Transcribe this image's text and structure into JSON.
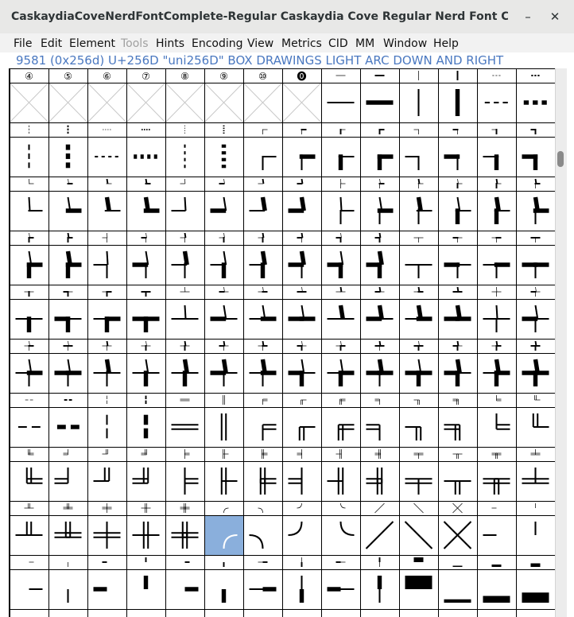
{
  "window": {
    "title": "CaskaydiaCoveNerdFontComplete-Regular  Caskaydia Cove Regular Nerd Font Complete.otf (...",
    "minimize_glyph": "–",
    "close_glyph": "✕"
  },
  "menu": [
    {
      "label": "File",
      "enabled": true
    },
    {
      "label": "Edit",
      "enabled": true
    },
    {
      "label": "Element",
      "enabled": true
    },
    {
      "label": "Tools",
      "enabled": false
    },
    {
      "label": "Hints",
      "enabled": true
    },
    {
      "label": "Encoding",
      "enabled": true
    },
    {
      "label": "View",
      "enabled": true
    },
    {
      "label": "Metrics",
      "enabled": true
    },
    {
      "label": "CID",
      "enabled": true
    },
    {
      "label": "MM",
      "enabled": true
    },
    {
      "label": "Window",
      "enabled": true
    },
    {
      "label": "Help",
      "enabled": true
    }
  ],
  "info": {
    "text": "9581 (0x256d) U+256D \"uni256D\" BOX DRAWINGS LIGHT ARC DOWN AND RIGHT"
  },
  "grid": {
    "selected_codepoint": "U+256D",
    "first_row_headers": [
      "④",
      "⑤",
      "⑥",
      "⑦",
      "⑧",
      "⑨",
      "⑩",
      "⓿"
    ],
    "first_row_empty_cells": 8,
    "rows": [
      [
        "④",
        "⑤",
        "⑥",
        "⑦",
        "⑧",
        "⑨",
        "⑩",
        "⓿",
        "─",
        "━",
        "│",
        "┃",
        "┄",
        "┅"
      ],
      [
        "┆",
        "┇",
        "┈",
        "┉",
        "┊",
        "┋",
        "┌",
        "┍",
        "┎",
        "┏",
        "┐",
        "┑",
        "┒",
        "┓"
      ],
      [
        "└",
        "┕",
        "┖",
        "┗",
        "┘",
        "┙",
        "┚",
        "┛",
        "├",
        "┝",
        "┞",
        "┟",
        "┠",
        "┡"
      ],
      [
        "┢",
        "┣",
        "┤",
        "┥",
        "┦",
        "┧",
        "┨",
        "┩",
        "┪",
        "┫",
        "┬",
        "┭",
        "┮",
        "┯"
      ],
      [
        "┰",
        "┱",
        "┲",
        "┳",
        "┴",
        "┵",
        "┶",
        "┷",
        "┸",
        "┹",
        "┺",
        "┻",
        "┼",
        "┽"
      ],
      [
        "┾",
        "┿",
        "╀",
        "╁",
        "╂",
        "╃",
        "╄",
        "╅",
        "╆",
        "╇",
        "╈",
        "╉",
        "╊",
        "╋"
      ],
      [
        "╌",
        "╍",
        "╎",
        "╏",
        "═",
        "║",
        "╒",
        "╓",
        "╔",
        "╕",
        "╖",
        "╗",
        "╘",
        "╙"
      ],
      [
        "╚",
        "╛",
        "╜",
        "╝",
        "╞",
        "╟",
        "╠",
        "╡",
        "╢",
        "╣",
        "╤",
        "╥",
        "╦",
        "╧"
      ],
      [
        "╨",
        "╩",
        "╪",
        "╫",
        "╬",
        "╭",
        "╮",
        "╯",
        "╰",
        "╱",
        "╲",
        "╳",
        "╴",
        "╵"
      ],
      [
        "╶",
        "╷",
        "╸",
        "╹",
        "╺",
        "╻",
        "╼",
        "╽",
        "╾",
        "╿",
        "▀",
        "▁",
        "▂",
        "▃"
      ]
    ],
    "grid_color": "#000000",
    "selection_color": "#8aafdc"
  }
}
